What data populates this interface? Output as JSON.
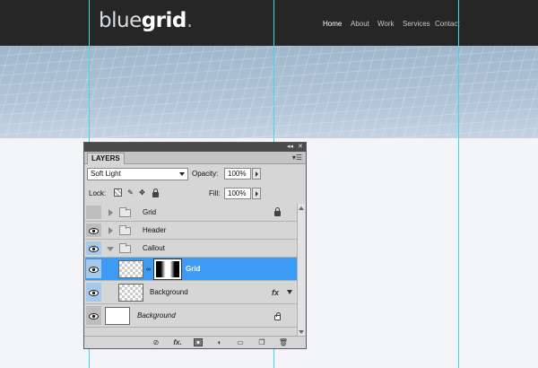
{
  "site": {
    "logo_light": "blue",
    "logo_bold": "grid",
    "logo_dot": ".",
    "nav": [
      {
        "label": "Home",
        "active": true
      },
      {
        "label": "About",
        "active": false
      },
      {
        "label": "Work",
        "active": false
      },
      {
        "label": "Services",
        "active": false
      },
      {
        "label": "Contact",
        "active": false
      }
    ]
  },
  "panel": {
    "tab_label": "LAYERS",
    "collapse_icon": "double-chevron-left-icon",
    "close_icon": "close-icon",
    "menu_icon": "panel-menu-icon",
    "blend_mode": "Soft Light",
    "opacity_label": "Opacity:",
    "opacity_value": "100%",
    "lock_label": "Lock:",
    "lock_icons": [
      "lock-transparent-icon",
      "lock-brush-icon",
      "lock-move-icon",
      "lock-all-icon"
    ],
    "fill_label": "Fill:",
    "fill_value": "100%",
    "layers": [
      {
        "name": "Grid",
        "kind": "group",
        "expanded": false,
        "visible": false,
        "locked": true
      },
      {
        "name": "Header",
        "kind": "group",
        "expanded": false,
        "visible": true
      },
      {
        "name": "Callout",
        "kind": "group",
        "expanded": true,
        "visible": true
      },
      {
        "name": "Grid",
        "kind": "layer-with-mask",
        "selected": true,
        "visible": true
      },
      {
        "name": "Background",
        "kind": "layer",
        "visible": true,
        "fx": "fx"
      },
      {
        "name": "Background",
        "kind": "background",
        "visible": true,
        "locked": true
      }
    ],
    "footer_icons": [
      "link-layers-icon",
      "fx-icon",
      "add-mask-icon",
      "adjustment-layer-icon",
      "new-group-icon",
      "new-layer-icon",
      "trash-icon"
    ],
    "footer_fx": "fx."
  },
  "colors": {
    "header_bg": "#262626",
    "guide": "#3fd8e8",
    "selection": "#3b9bf5",
    "eye_highlight": "#a6c8ea"
  }
}
